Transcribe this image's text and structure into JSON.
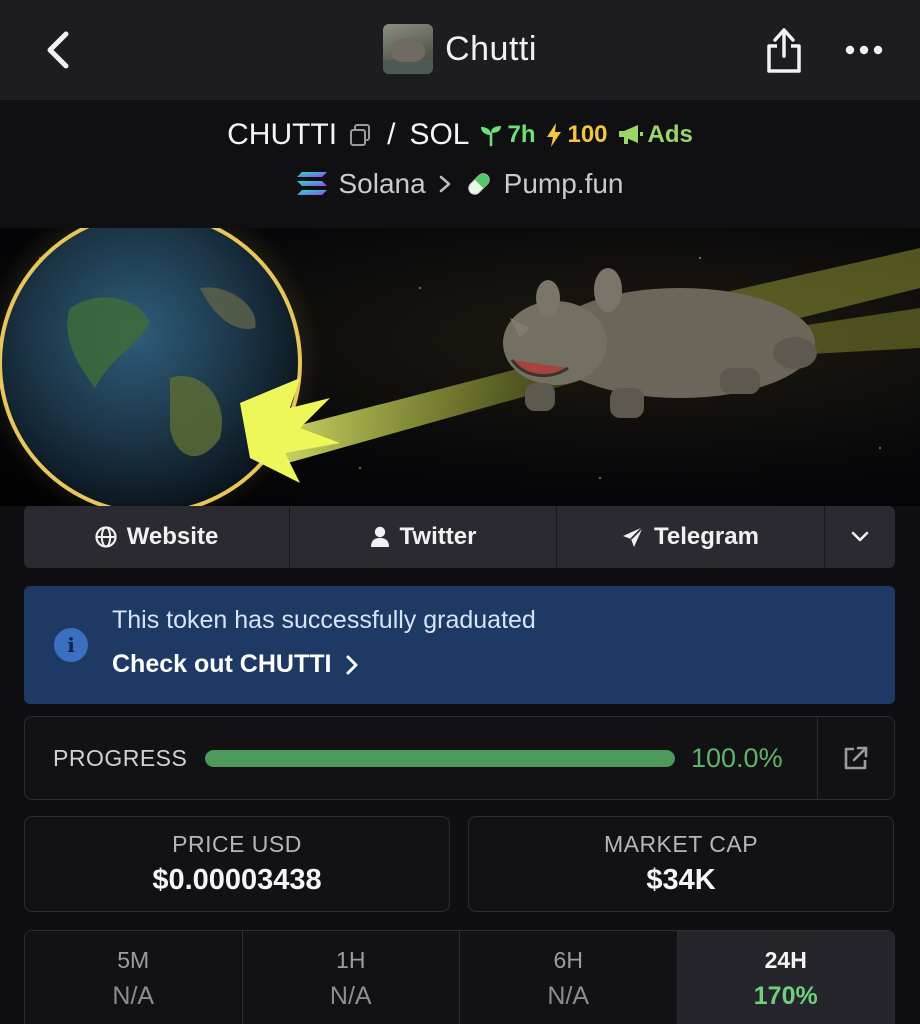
{
  "nav": {
    "title": "Chutti",
    "back_icon": "chevron-left-icon",
    "share_icon": "share-icon",
    "more_icon": "ellipsis-icon"
  },
  "pair": {
    "base": "CHUTTI",
    "separator": "/",
    "quote": "SOL",
    "age": "7h",
    "boost": "100",
    "ads": "Ads"
  },
  "chain": {
    "network": "Solana",
    "dex": "Pump.fun"
  },
  "links": [
    {
      "label": "Website",
      "icon": "globe-icon"
    },
    {
      "label": "Twitter",
      "icon": "user-icon"
    },
    {
      "label": "Telegram",
      "icon": "send-icon"
    }
  ],
  "info": {
    "message": "This token has successfully graduated",
    "cta": "Check out CHUTTI"
  },
  "progress": {
    "label": "PROGRESS",
    "value_text": "100.0%",
    "fraction": 1.0
  },
  "stats": {
    "price_label": "PRICE USD",
    "price_value": "$0.00003438",
    "mcap_label": "MARKET CAP",
    "mcap_value": "$34K"
  },
  "timeframes": [
    {
      "label": "5M",
      "value": "N/A"
    },
    {
      "label": "1H",
      "value": "N/A"
    },
    {
      "label": "6H",
      "value": "N/A"
    },
    {
      "label": "24H",
      "value": "170%"
    }
  ],
  "colors": {
    "accent_green": "#6fcf7c",
    "info_bg": "#1e3a64",
    "boost_yellow": "#f4c542"
  }
}
